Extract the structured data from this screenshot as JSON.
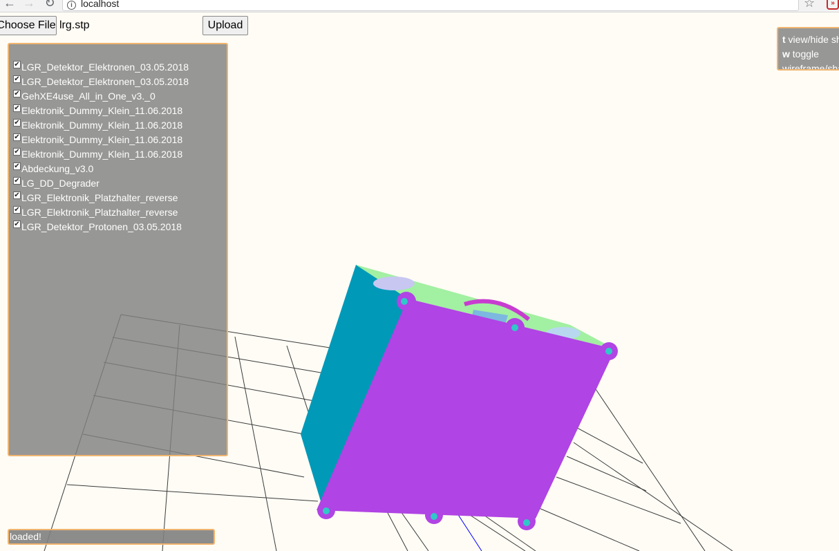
{
  "browser": {
    "url": "localhost",
    "back_icon": "arrow-left-icon",
    "forward_icon": "arrow-right-icon",
    "reload_icon": "reload-icon",
    "bookmark_icon": "star-icon"
  },
  "upload": {
    "choose_file_label": "Choose File",
    "file_name": "lrg.stp",
    "upload_label": "Upload"
  },
  "parts": [
    {
      "label": "LGR_Detektor_Elektronen_03.05.2018",
      "checked": true
    },
    {
      "label": "LGR_Detektor_Elektronen_03.05.2018",
      "checked": true
    },
    {
      "label": "GehXE4use_All_in_One_v3._0",
      "checked": true
    },
    {
      "label": "Elektronik_Dummy_Klein_11.06.2018",
      "checked": true
    },
    {
      "label": "Elektronik_Dummy_Klein_11.06.2018",
      "checked": true
    },
    {
      "label": "Elektronik_Dummy_Klein_11.06.2018",
      "checked": true
    },
    {
      "label": "Elektronik_Dummy_Klein_11.06.2018",
      "checked": true
    },
    {
      "label": "Abdeckung_v3.0",
      "checked": true
    },
    {
      "label": "LG_DD_Degrader",
      "checked": true
    },
    {
      "label": "LGR_Elektronik_Platzhalter_reverse",
      "checked": true
    },
    {
      "label": "LGR_Elektronik_Platzhalter_reverse",
      "checked": true
    },
    {
      "label": "LGR_Detektor_Protonen_03.05.2018",
      "checked": true
    }
  ],
  "help": {
    "key1": "t",
    "text1": " view/hide sh",
    "key2": "w",
    "text2": " toggle",
    "text3": "wireframe/sha"
  },
  "status": {
    "text": "loaded!"
  },
  "colors": {
    "panel_border": "#f0b46e",
    "panel_bg": "#808080",
    "box_front": "#b044e4",
    "box_side": "#0099b8",
    "box_top": "#a0f0a0",
    "background": "#fffcf5"
  }
}
